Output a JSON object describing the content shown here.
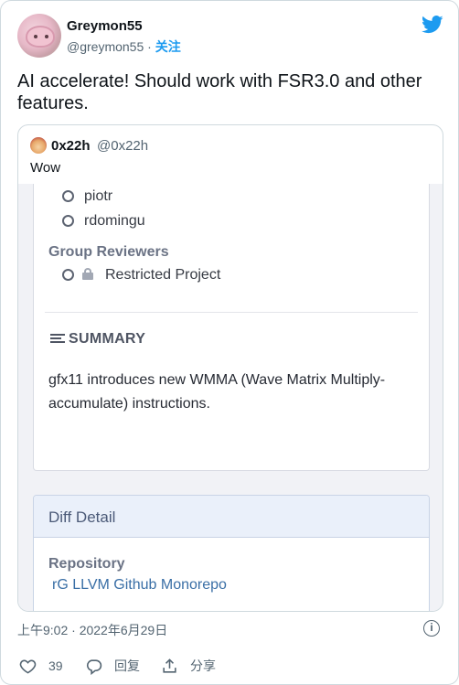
{
  "author": {
    "display_name": "Greymon55",
    "handle": "@greymon55",
    "separator": " · ",
    "follow_label": "关注"
  },
  "tweet": {
    "text": "AI accelerate! Should work with FSR3.0 and other features."
  },
  "quoted": {
    "display_name": "0x22h",
    "handle": "@0x22h",
    "text": "Wow",
    "screenshot": {
      "reviewers": [
        "piotr",
        "rdomingu"
      ],
      "group_reviewers_title": "Group Reviewers",
      "group_reviewer": "Restricted Project",
      "summary_title": "SUMMARY",
      "summary_text": "gfx11 introduces new WMMA (Wave Matrix Multiply-accumulate) instructions.",
      "diff_detail_title": "Diff Detail",
      "repository_label": "Repository",
      "repository_value": "rG LLVM Github Monorepo"
    }
  },
  "footer": {
    "timestamp": "上午9:02 · 2022年6月29日",
    "info_icon": "info-icon",
    "likes_count": "39",
    "reply_label": "回复",
    "share_label": "分享"
  },
  "colors": {
    "brand": "#1d9bf0",
    "text": "#0f1419",
    "muted": "#536471",
    "link": "#3a6fa6"
  }
}
